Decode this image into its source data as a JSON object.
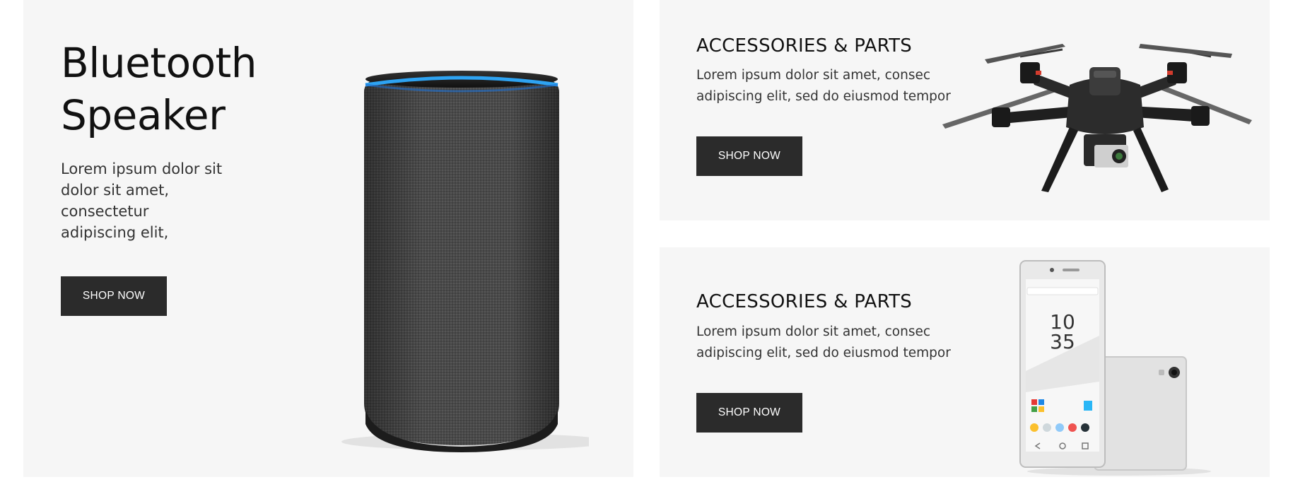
{
  "main_banner": {
    "title_line1": "Bluetooth",
    "title_line2": "Speaker",
    "desc_line1": "Lorem ipsum dolor sit",
    "desc_line2": "dolor sit amet,",
    "desc_line3": "consectetur",
    "desc_line4": "adipiscing elit,",
    "button_label": "SHOP NOW"
  },
  "top_banner": {
    "title": "ACCESSORIES & PARTS",
    "desc_line1": "Lorem ipsum dolor sit amet, consec",
    "desc_line2": "adipiscing elit, sed do eiusmod tempor",
    "button_label": "SHOP NOW"
  },
  "bottom_banner": {
    "title": "ACCESSORIES & PARTS",
    "desc_line1": "Lorem ipsum dolor sit amet, consec",
    "desc_line2": "adipiscing elit, sed do eiusmod tempor",
    "button_label": "SHOP NOW",
    "phone_time_hour": "10",
    "phone_time_minute": "35"
  },
  "colors": {
    "banner_bg": "#f6f6f6",
    "button_bg": "#2b2b2b",
    "speaker_ring": "#1e88e5"
  }
}
